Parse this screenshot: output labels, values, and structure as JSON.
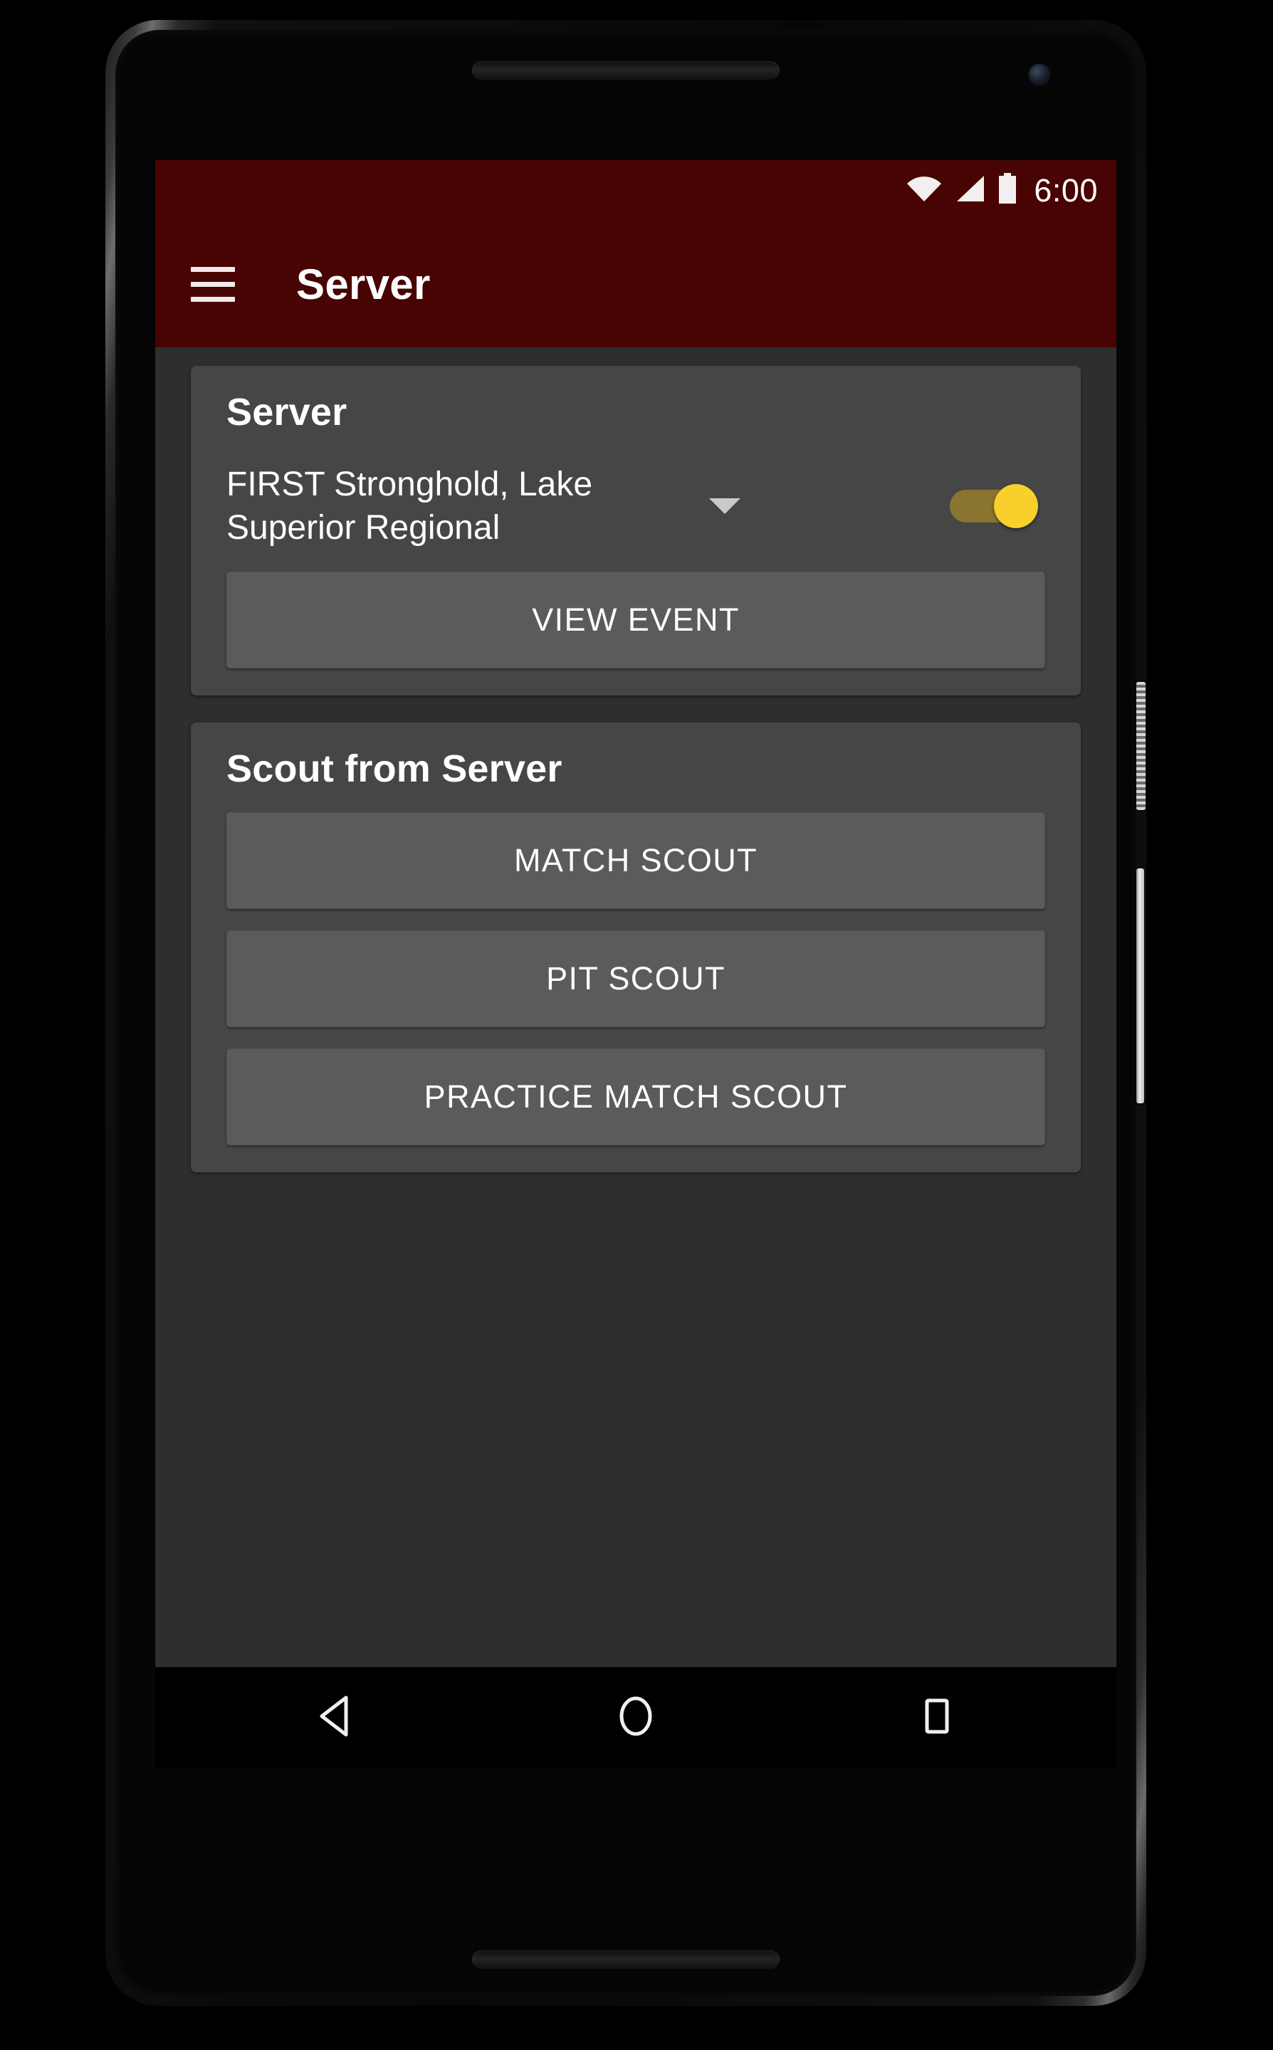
{
  "status_bar": {
    "clock": "6:00",
    "icons": [
      "wifi-icon",
      "cellular-signal-icon",
      "battery-icon"
    ],
    "background_color": "#470402"
  },
  "app_bar": {
    "menu_icon": "hamburger-menu-icon",
    "title": "Server",
    "background_color": "#470402",
    "title_color": "#ffffff"
  },
  "server_card": {
    "title": "Server",
    "event_spinner": {
      "selected_value": "FIRST Stronghold, Lake Superior Regional",
      "caret_icon": "chevron-down-icon"
    },
    "toggle": {
      "state": "on",
      "thumb_color": "#f9cf2c",
      "track_color": "#8a7530"
    },
    "view_event_label": "VIEW EVENT"
  },
  "scout_card": {
    "title": "Scout from Server",
    "buttons": [
      {
        "label": "MATCH SCOUT"
      },
      {
        "label": "PIT SCOUT"
      },
      {
        "label": "PRACTICE MATCH SCOUT"
      }
    ]
  },
  "nav_bar": {
    "back_icon": "back-triangle-icon",
    "home_icon": "home-circle-icon",
    "recents_icon": "recents-square-icon"
  },
  "theme": {
    "page_background": "#2e2e2e",
    "card_background": "#464646",
    "button_background": "#5b5b5d",
    "accent": "#f9cf2c"
  }
}
